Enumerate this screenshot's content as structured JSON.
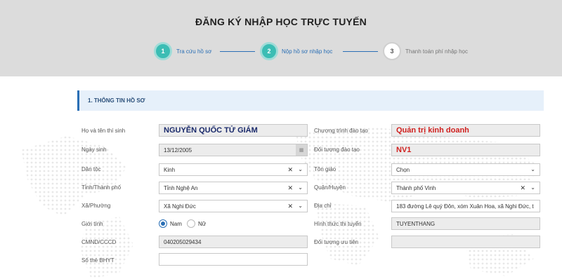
{
  "page": {
    "title": "ĐĂNG KÝ NHẬP HỌC TRỰC TUYẾN"
  },
  "steps": [
    {
      "number": "1",
      "label": "Tra cứu hồ sơ",
      "state": "done"
    },
    {
      "number": "2",
      "label": "Nộp hồ sơ nhập học",
      "state": "current"
    },
    {
      "number": "3",
      "label": "Thanh toán phí nhập học",
      "state": "pending"
    }
  ],
  "section": {
    "title": "1. THÔNG TIN HỒ SƠ"
  },
  "form": {
    "ho_ten": {
      "label": "Họ và tên thí sinh",
      "value": "NGUYỄN QUỐC TỬ GIÁM"
    },
    "ngay_sinh": {
      "label": "Ngày sinh",
      "value": "13/12/2005"
    },
    "dan_toc": {
      "label": "Dân tộc",
      "value": "Kinh"
    },
    "tinh": {
      "label": "Tỉnh/Thành phố",
      "value": "Tỉnh Nghệ An"
    },
    "xa": {
      "label": "Xã/Phường",
      "value": "Xã Nghi Đức"
    },
    "gioi_tinh": {
      "label": "Giới tính",
      "options": [
        "Nam",
        "Nữ"
      ],
      "selected": "Nam"
    },
    "cmnd": {
      "label": "CMND/CCCD",
      "value": "040205029434"
    },
    "bhyt": {
      "label": "Số thẻ BHYT",
      "value": ""
    },
    "chuong_trinh": {
      "label": "Chương trình đào tạo",
      "value": "Quản trị kinh doanh"
    },
    "doi_tuong_dt": {
      "label": "Đối tượng đào tạo",
      "value": "NV1"
    },
    "ton_giao": {
      "label": "Tôn giáo",
      "value": "Chọn"
    },
    "quan": {
      "label": "Quận/Huyện",
      "value": "Thành phố Vinh"
    },
    "dia_chi": {
      "label": "Địa chỉ",
      "value": "183 đường Lê quý Đôn, xóm Xuân Hoa, xã Nghi Đức, t"
    },
    "hinh_thuc": {
      "label": "Hình thức thi tuyển",
      "value": "TUYENTHANG"
    },
    "uu_tien": {
      "label": "Đối tượng ưu tiên",
      "value": ""
    }
  },
  "icons": {
    "clear": "✕",
    "chevron": "⌄",
    "calendar": "▦"
  },
  "colors": {
    "accent": "#3bbdb4",
    "link": "#2a6fb5",
    "highlight_red": "#d0201e",
    "name_navy": "#1a2a6b"
  }
}
